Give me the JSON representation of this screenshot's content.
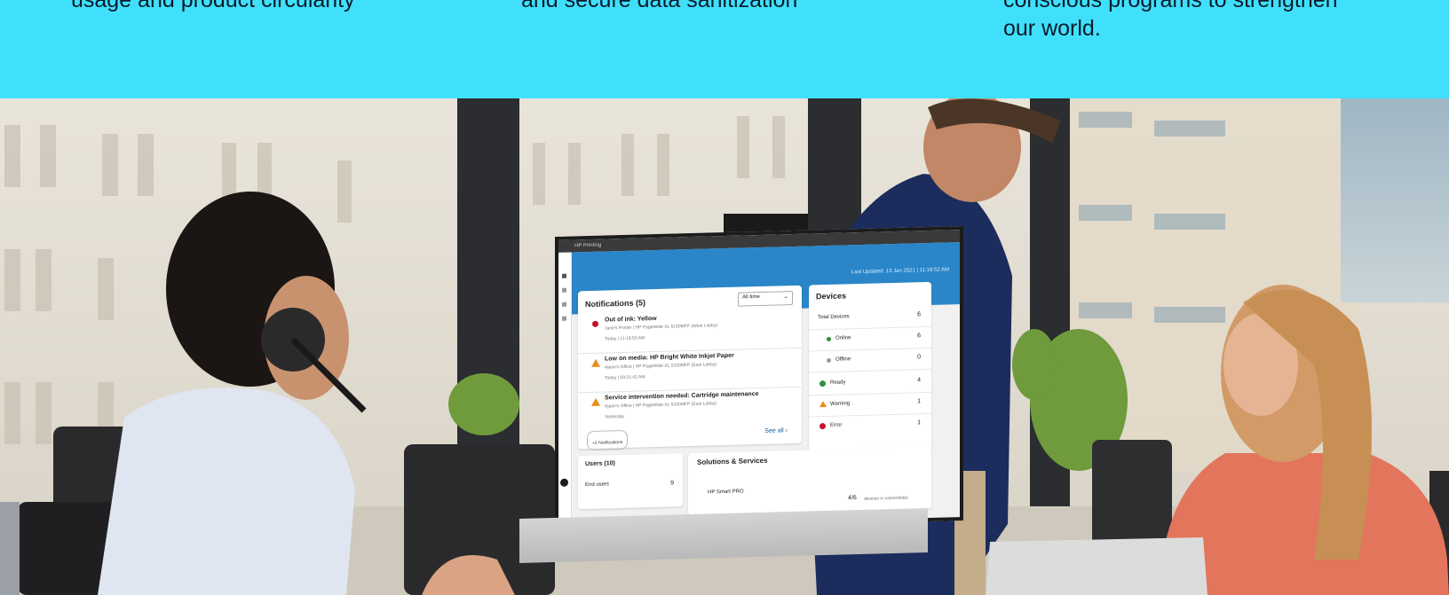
{
  "band": {
    "col1": "usage and product circularity",
    "col2": "and secure data sanitization",
    "col3_line1": "conscious programs to strengthen",
    "col3_line2": "our world."
  },
  "monitor_ui": {
    "window_title": "HP Printing",
    "last_updated": "Last Updated: 13 Jan 2021 | 11:19:52 AM",
    "notifications": {
      "title": "Notifications (5)",
      "filter": "All time",
      "items": [
        {
          "title": "Out of ink: Yellow",
          "subtitle": "Jane's Printer | HP PageWide XL 5100MFP (West Lobby)",
          "time": "Today | 11:19:53 AM"
        },
        {
          "title": "Low on media: HP Bright White Inkjet Paper",
          "subtitle": "Ajean's Office | HP PageWide XL 5100MFP (East Lobby)",
          "time": "Today | 09:21:42 AM"
        },
        {
          "title": "Service intervention needed: Cartridge maintenance",
          "subtitle": "Ajean's Office | HP PageWide XL 5100MFP (East Lobby)",
          "time": "Yesterday"
        }
      ],
      "more": "+2 Notifications",
      "see_all": "See all"
    },
    "devices": {
      "title": "Devices",
      "rows": [
        {
          "label": "Total Devices",
          "value": "6"
        },
        {
          "label": "Online",
          "value": "6"
        },
        {
          "label": "Offline",
          "value": "0"
        },
        {
          "label": "Ready",
          "value": "4"
        },
        {
          "label": "Warning",
          "value": "1"
        },
        {
          "label": "Error",
          "value": "1"
        }
      ]
    },
    "users": {
      "title": "Users (10)",
      "row_label": "End users",
      "row_value": "9"
    },
    "solutions": {
      "title": "Solutions & Services",
      "item": "HP Smart PRO",
      "item_value": "4/6",
      "item_note": "devices in use/entitled"
    }
  },
  "colors": {
    "band": "#40e0fc",
    "ui_blue": "#2a86c8"
  }
}
